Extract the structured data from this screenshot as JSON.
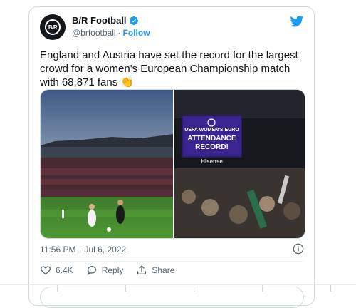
{
  "account": {
    "name": "B/R Football",
    "handle": "@brfootball",
    "separator": "·",
    "follow_label": "Follow",
    "avatar_text": "B/R"
  },
  "tweet": {
    "text": "England and Austria have set the record for the largest crowd for a women's European Championship match with 68,871 fans 👏",
    "time": "11:56 PM",
    "dot": "·",
    "date": "Jul 6, 2022"
  },
  "media": {
    "scoreboard_line1": "UEFA WOMEN'S EURO",
    "scoreboard_line2": "ATTENDANCE",
    "scoreboard_line3": "RECORD!",
    "sponsor": "Hisense"
  },
  "actions": {
    "likes": "6.4K",
    "reply_label": "Reply",
    "share_label": "Share"
  },
  "colors": {
    "accent": "#1d9bf0",
    "like": "#536471"
  }
}
